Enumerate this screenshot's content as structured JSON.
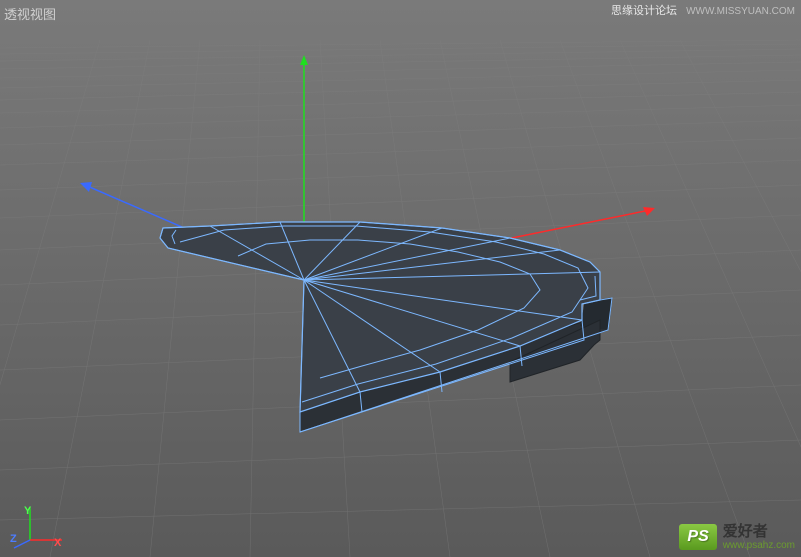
{
  "viewport": {
    "label": "透视视图"
  },
  "watermark": {
    "forum": "思缘设计论坛",
    "forum_url": "WWW.MISSYUAN.COM"
  },
  "axes": {
    "x": "X",
    "y": "Y",
    "z": "Z"
  },
  "brand": {
    "badge": "PS",
    "name": "爱好者",
    "url": "www.psahz.com"
  },
  "scene": {
    "object": "extruded-wedge-mesh",
    "selected": true,
    "wireframe_color": "#7db8ff",
    "fill_color": "#3a4048"
  }
}
